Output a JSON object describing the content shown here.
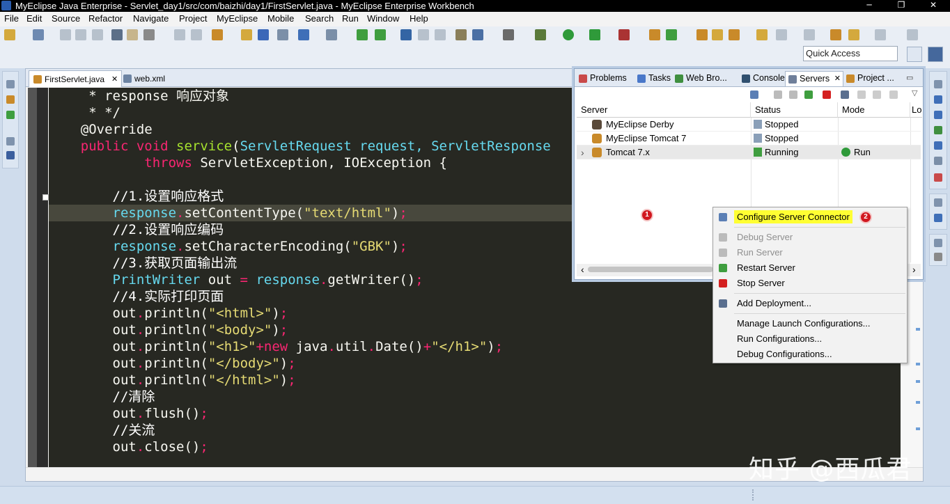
{
  "window": {
    "title": "MyEclipse Java Enterprise - Servlet_day1/src/com/baizhi/day1/FirstServlet.java - MyEclipse Enterprise Workbench",
    "minimize": "─",
    "restore": "❐",
    "close": "✕"
  },
  "menu": [
    "File",
    "Edit",
    "Source",
    "Refactor",
    "Navigate",
    "Project",
    "MyEclipse",
    "Mobile",
    "Search",
    "Run",
    "Window",
    "Help"
  ],
  "quick_access": {
    "placeholder": "Quick Access"
  },
  "editor": {
    "tabs": [
      {
        "label": "FirstServlet.java",
        "close": "✕"
      },
      {
        "label": "web.xml"
      }
    ],
    "lines": [
      [
        {
          "t": "     * response ",
          "c": "a"
        },
        {
          "t": "响应对象",
          "c": "a"
        }
      ],
      [
        {
          "t": "     * */",
          "c": "a"
        }
      ],
      [
        {
          "t": "    @Override",
          "c": "a"
        }
      ],
      [
        {
          "t": "    public void ",
          "c": "k"
        },
        {
          "t": "service",
          "c": "f"
        },
        {
          "t": "(",
          "c": "a"
        },
        {
          "t": "ServletRequest",
          "c": "t"
        },
        {
          "t": " request, ",
          "c": "t"
        },
        {
          "t": "ServletResponse",
          "c": "t"
        }
      ],
      [
        {
          "t": "            throws ",
          "c": "k"
        },
        {
          "t": "ServletException, IOException {",
          "c": "a"
        }
      ],
      [
        {
          "t": "",
          "c": "a"
        }
      ],
      [
        {
          "t": "        //1.设置响应格式",
          "c": "c"
        }
      ],
      [
        {
          "t": "        response",
          "c": "t"
        },
        {
          "t": ".",
          "c": "p"
        },
        {
          "t": "setContentType(",
          "c": "a"
        },
        {
          "t": "\"text/html\"",
          "c": "s"
        },
        {
          "t": ")",
          "c": "a"
        },
        {
          "t": ";",
          "c": "p"
        }
      ],
      [
        {
          "t": "        //2.设置响应编码",
          "c": "c"
        }
      ],
      [
        {
          "t": "        response",
          "c": "t"
        },
        {
          "t": ".",
          "c": "p"
        },
        {
          "t": "setCharacterEncoding(",
          "c": "a"
        },
        {
          "t": "\"GBK\"",
          "c": "s"
        },
        {
          "t": ")",
          "c": "a"
        },
        {
          "t": ";",
          "c": "p"
        }
      ],
      [
        {
          "t": "        //3.获取页面输出流",
          "c": "c"
        }
      ],
      [
        {
          "t": "        PrintWriter ",
          "c": "t"
        },
        {
          "t": "out ",
          "c": "a"
        },
        {
          "t": "= ",
          "c": "p"
        },
        {
          "t": "response",
          "c": "t"
        },
        {
          "t": ".",
          "c": "p"
        },
        {
          "t": "getWriter()",
          "c": "a"
        },
        {
          "t": ";",
          "c": "p"
        }
      ],
      [
        {
          "t": "        //4.实际打印页面",
          "c": "c"
        }
      ],
      [
        {
          "t": "        out",
          "c": "a"
        },
        {
          "t": ".",
          "c": "p"
        },
        {
          "t": "println(",
          "c": "a"
        },
        {
          "t": "\"<html>\"",
          "c": "s"
        },
        {
          "t": ")",
          "c": "a"
        },
        {
          "t": ";",
          "c": "p"
        }
      ],
      [
        {
          "t": "        out",
          "c": "a"
        },
        {
          "t": ".",
          "c": "p"
        },
        {
          "t": "println(",
          "c": "a"
        },
        {
          "t": "\"<body>\"",
          "c": "s"
        },
        {
          "t": ")",
          "c": "a"
        },
        {
          "t": ";",
          "c": "p"
        }
      ],
      [
        {
          "t": "        out",
          "c": "a"
        },
        {
          "t": ".",
          "c": "p"
        },
        {
          "t": "println(",
          "c": "a"
        },
        {
          "t": "\"<h1>\"",
          "c": "s"
        },
        {
          "t": "+",
          "c": "p"
        },
        {
          "t": "new ",
          "c": "k"
        },
        {
          "t": "java",
          "c": "a"
        },
        {
          "t": ".",
          "c": "p"
        },
        {
          "t": "util",
          "c": "a"
        },
        {
          "t": ".",
          "c": "p"
        },
        {
          "t": "Date()",
          "c": "a"
        },
        {
          "t": "+",
          "c": "p"
        },
        {
          "t": "\"</h1>\"",
          "c": "s"
        },
        {
          "t": ")",
          "c": "a"
        },
        {
          "t": ";",
          "c": "p"
        }
      ],
      [
        {
          "t": "        out",
          "c": "a"
        },
        {
          "t": ".",
          "c": "p"
        },
        {
          "t": "println(",
          "c": "a"
        },
        {
          "t": "\"</body>\"",
          "c": "s"
        },
        {
          "t": ")",
          "c": "a"
        },
        {
          "t": ";",
          "c": "p"
        }
      ],
      [
        {
          "t": "        out",
          "c": "a"
        },
        {
          "t": ".",
          "c": "p"
        },
        {
          "t": "println(",
          "c": "a"
        },
        {
          "t": "\"</html>\"",
          "c": "s"
        },
        {
          "t": ")",
          "c": "a"
        },
        {
          "t": ";",
          "c": "p"
        }
      ],
      [
        {
          "t": "        //清除",
          "c": "c"
        }
      ],
      [
        {
          "t": "        out",
          "c": "a"
        },
        {
          "t": ".",
          "c": "p"
        },
        {
          "t": "flush()",
          "c": "a"
        },
        {
          "t": ";",
          "c": "p"
        }
      ],
      [
        {
          "t": "        //关流",
          "c": "c"
        }
      ],
      [
        {
          "t": "        out",
          "c": "a"
        },
        {
          "t": ".",
          "c": "p"
        },
        {
          "t": "close()",
          "c": "a"
        },
        {
          "t": ";",
          "c": "p"
        }
      ]
    ]
  },
  "servers_view": {
    "tabs": [
      {
        "label": "Problems",
        "color": "#c94a4a"
      },
      {
        "label": "Tasks",
        "color": "#4a78c9"
      },
      {
        "label": "Web Bro...",
        "color": "#3f8f3f"
      },
      {
        "label": "Console",
        "color": "#30506f"
      },
      {
        "label": "Servers",
        "color": "#6f7f9a",
        "close": "✕"
      },
      {
        "label": "Project ...",
        "color": "#c98a2a"
      }
    ],
    "columns": [
      "Server",
      "Status",
      "Mode",
      "Lo"
    ],
    "rows": [
      {
        "expand": "",
        "server": "MyEclipse Derby",
        "status": "Stopped",
        "mode": ""
      },
      {
        "expand": "",
        "server": "MyEclipse Tomcat 7",
        "status": "Stopped",
        "mode": ""
      },
      {
        "expand": "›",
        "server": "Tomcat  7.x",
        "status": "Running",
        "mode": "Run"
      }
    ],
    "scroll_left": "‹",
    "scroll_right": "›"
  },
  "context_menu": [
    {
      "label": "Configure Server Connector",
      "enabled": true,
      "highlight": true,
      "icon": "#5b7fb5"
    },
    {
      "separator": true
    },
    {
      "label": "Debug Server",
      "enabled": false,
      "icon": "#bbbbbb"
    },
    {
      "label": "Run Server",
      "enabled": false,
      "icon": "#bbbbbb"
    },
    {
      "label": "Restart Server",
      "enabled": true,
      "icon": "#3f9e3f"
    },
    {
      "label": "Stop Server",
      "enabled": true,
      "icon": "#d42020"
    },
    {
      "separator": true
    },
    {
      "label": "Add Deployment...",
      "enabled": true,
      "icon": "#5a6f8f"
    },
    {
      "separator": true
    },
    {
      "label": "Manage Launch Configurations...",
      "enabled": true
    },
    {
      "label": "Run Configurations...",
      "enabled": true
    },
    {
      "label": "Debug Configurations...",
      "enabled": true
    }
  ],
  "badges": [
    "1",
    "2"
  ],
  "watermark": "知乎 @西瓜君",
  "colors": {
    "editor_bg": "#272822",
    "highlight": "#ffff33",
    "badge": "#d1171f",
    "running": "#2f9a3a"
  }
}
